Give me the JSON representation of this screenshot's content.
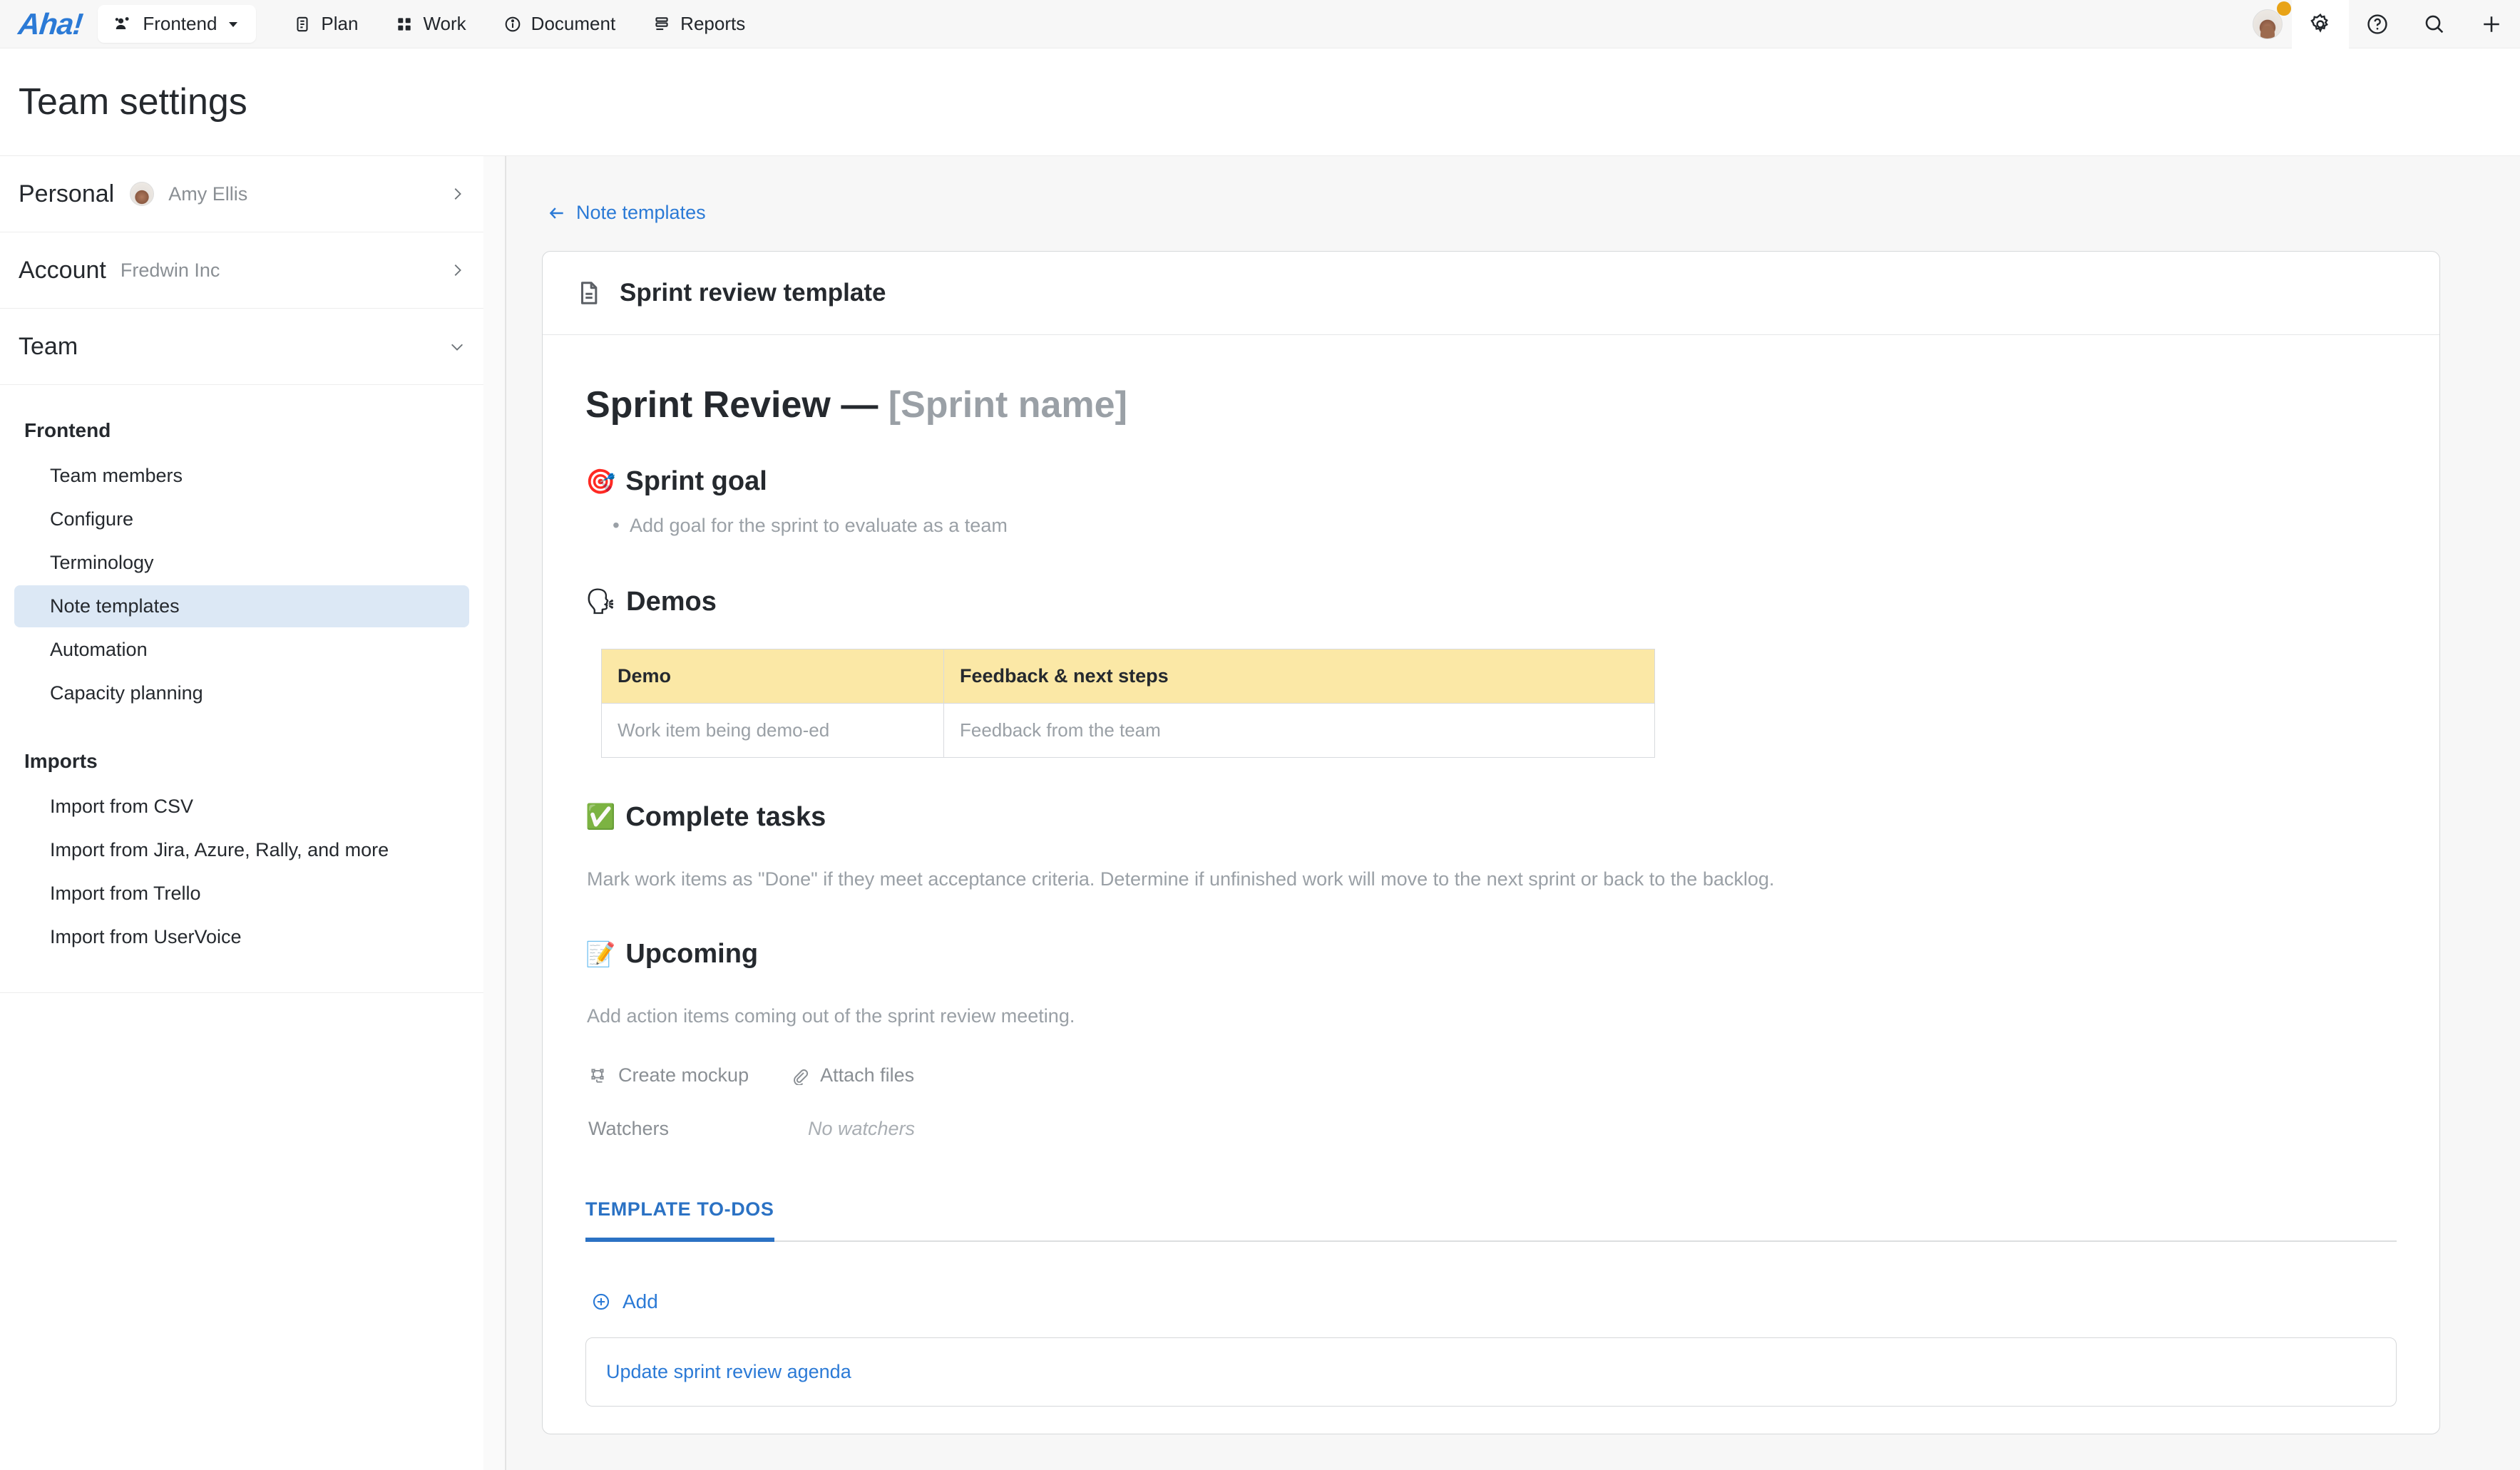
{
  "topnav": {
    "logo": "Aha!",
    "workspace": {
      "label": "Frontend",
      "icon": "people-icon",
      "chevron": "▾"
    },
    "items": [
      {
        "label": "Plan",
        "icon": "clipboard-icon"
      },
      {
        "label": "Work",
        "icon": "grid-icon"
      },
      {
        "label": "Document",
        "icon": "info-circle-icon"
      },
      {
        "label": "Reports",
        "icon": "report-icon"
      }
    ],
    "right_icons": [
      {
        "name": "avatar",
        "has_badge": true
      },
      {
        "name": "gear-icon"
      },
      {
        "name": "help-icon"
      },
      {
        "name": "search-icon"
      },
      {
        "name": "plus-icon"
      }
    ]
  },
  "page": {
    "title": "Team settings"
  },
  "sidebar": {
    "rows": [
      {
        "key": "Personal",
        "value": "Amy Ellis",
        "chevron": "›",
        "has_avatar": true
      },
      {
        "key": "Account",
        "value": "Fredwin Inc",
        "chevron": "›",
        "has_avatar": false
      },
      {
        "key": "Team",
        "value": "",
        "chevron": "⌄",
        "has_avatar": false
      }
    ],
    "groups": [
      {
        "heading": "Frontend",
        "links": [
          {
            "label": "Team members",
            "active": false
          },
          {
            "label": "Configure",
            "active": false
          },
          {
            "label": "Terminology",
            "active": false
          },
          {
            "label": "Note templates",
            "active": true
          },
          {
            "label": "Automation",
            "active": false
          },
          {
            "label": "Capacity planning",
            "active": false
          }
        ]
      },
      {
        "heading": "Imports",
        "links": [
          {
            "label": "Import from CSV",
            "active": false
          },
          {
            "label": "Import from Jira, Azure, Rally, and more",
            "active": false
          },
          {
            "label": "Import from Trello",
            "active": false
          },
          {
            "label": "Import from UserVoice",
            "active": false
          }
        ]
      }
    ]
  },
  "main": {
    "back_link": "Note templates",
    "card_title": "Sprint review template",
    "card_icon": "document-icon",
    "doc_title_main": "Sprint Review — ",
    "doc_title_placeholder": "[Sprint name]",
    "sections": {
      "sprint_goal": {
        "emoji": "🎯",
        "heading": "Sprint goal",
        "bullets": [
          "Add goal for the sprint to evaluate as a team"
        ]
      },
      "demos": {
        "emoji": "🗣",
        "heading": "Demos",
        "table": {
          "headers": [
            "Demo",
            "Feedback & next steps"
          ],
          "rows": [
            [
              "Work item being demo-ed",
              "Feedback from the team"
            ]
          ],
          "header_bg": "#fbe8a6"
        }
      },
      "complete_tasks": {
        "emoji": "✅",
        "heading": "Complete tasks",
        "paragraph": "Mark work items as \"Done\" if they meet acceptance criteria. Determine if unfinished work will move to the next sprint or back to the backlog."
      },
      "upcoming": {
        "emoji": "📝",
        "heading": "Upcoming",
        "paragraph": "Add action items coming out of the sprint review meeting."
      }
    },
    "actions": [
      {
        "label": "Create mockup",
        "icon": "mockup-icon"
      },
      {
        "label": "Attach files",
        "icon": "paperclip-icon"
      }
    ],
    "watchers": {
      "label": "Watchers",
      "value": "No watchers"
    },
    "tabs": [
      {
        "label": "TEMPLATE TO-DOS",
        "active": true
      }
    ],
    "add_button": {
      "label": "Add",
      "icon": "plus-circle-icon"
    },
    "todos": [
      {
        "text": "Update sprint review agenda"
      }
    ]
  },
  "colors": {
    "accent_blue": "#2b7ad6",
    "tab_blue": "#2b72c4",
    "active_sidebar_bg": "#dce8f5",
    "table_header": "#fbe8a6",
    "badge_orange": "#e8a317",
    "page_bg": "#f7f7f7"
  }
}
